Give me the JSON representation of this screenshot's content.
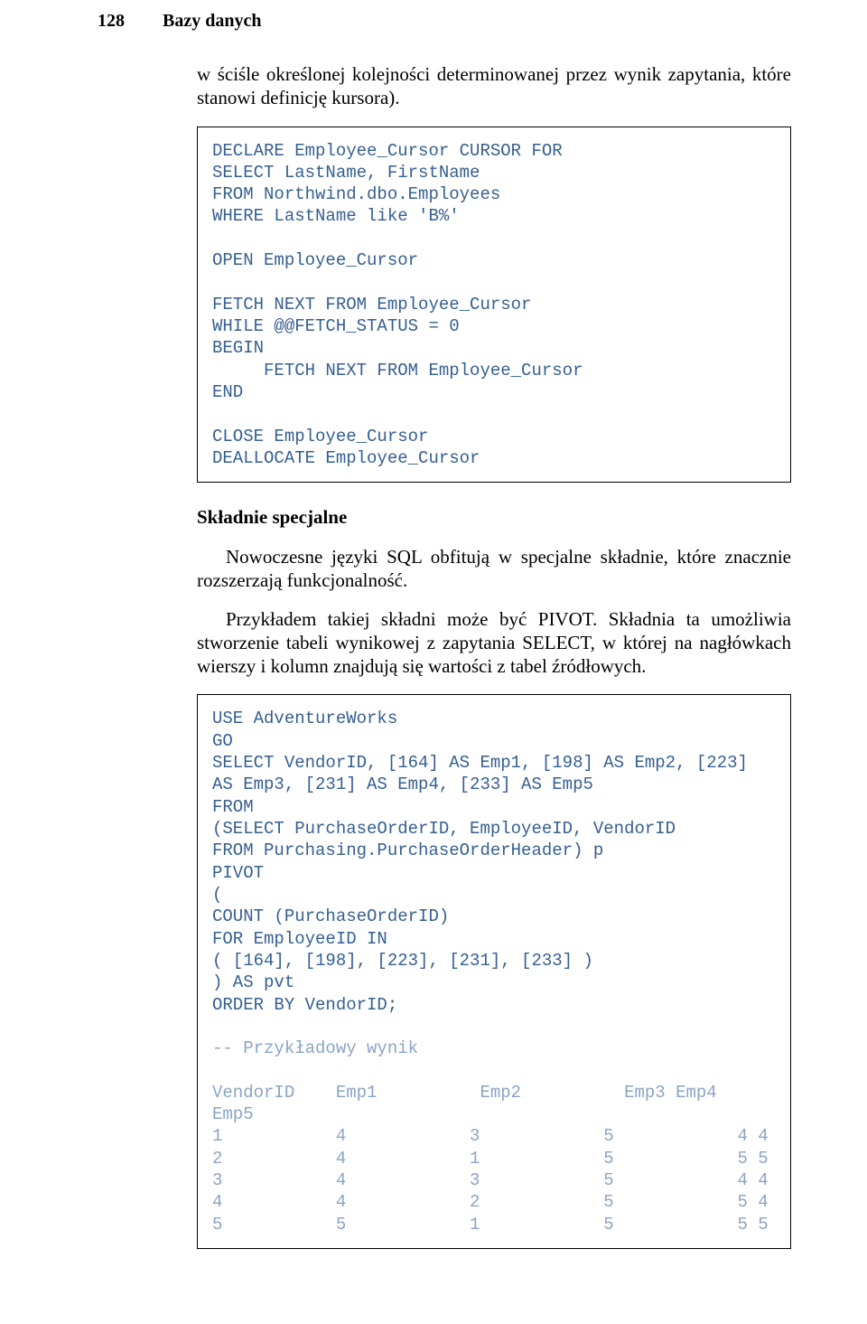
{
  "header": {
    "page_number": "128",
    "section": "Bazy danych"
  },
  "intro_para": "w ściśle określonej kolejności determinowanej przez wynik zapytania, które stanowi definicję kursora).",
  "code1": "DECLARE Employee_Cursor CURSOR FOR\nSELECT LastName, FirstName\nFROM Northwind.dbo.Employees\nWHERE LastName like 'B%'\n\nOPEN Employee_Cursor\n\nFETCH NEXT FROM Employee_Cursor\nWHILE @@FETCH_STATUS = 0\nBEGIN\n     FETCH NEXT FROM Employee_Cursor\nEND\n\nCLOSE Employee_Cursor\nDEALLOCATE Employee_Cursor",
  "subheading": "Składnie specjalne",
  "para2": "Nowoczesne języki SQL obfitują w specjalne składnie, które znacznie rozszerzają funkcjonalność.",
  "para3": "Przykładem takiej składni może być PIVOT. Składnia ta umożliwia stworzenie tabeli wynikowej z zapytania SELECT, w której na nagłówkach wierszy i kolumn znajdują się wartości z tabel źródłowych.",
  "code2_main": "USE AdventureWorks\nGO\nSELECT VendorID, [164] AS Emp1, [198] AS Emp2, [223] AS Emp3, [231] AS Emp4, [233] AS Emp5\nFROM\n(SELECT PurchaseOrderID, EmployeeID, VendorID\nFROM Purchasing.PurchaseOrderHeader) p\nPIVOT\n(\nCOUNT (PurchaseOrderID)\nFOR EmployeeID IN\n( [164], [198], [223], [231], [233] )\n) AS pvt\nORDER BY VendorID;\n",
  "code2_comment": "-- Przykładowy wynik\n",
  "code2_header": "VendorID    Emp1          Emp2          Emp3 Emp4      Emp5",
  "code2_data": "1           4            3            5            4 4\n2           4            1            5            5 5\n3           4            3            5            4 4\n4           4            2            5            5 4\n5           5            1            5            5 5"
}
